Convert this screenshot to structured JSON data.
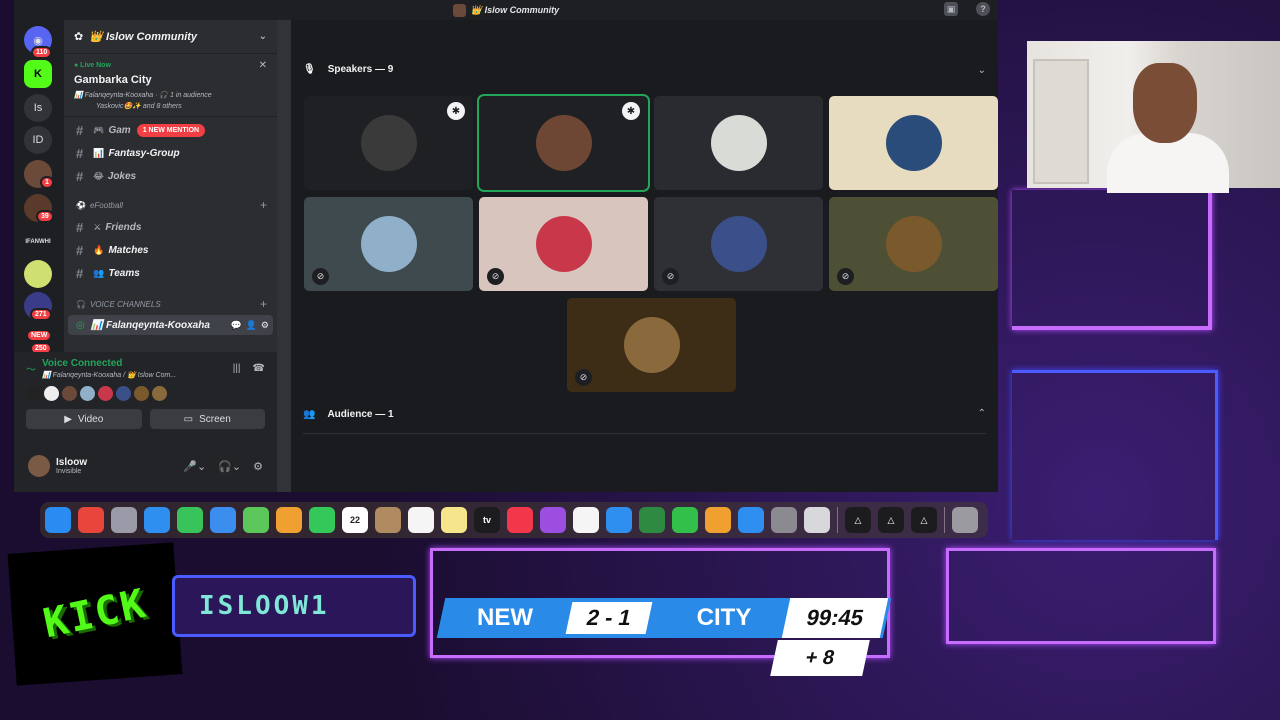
{
  "window": {
    "title": "👑 Islow Community"
  },
  "rail": {
    "items": [
      {
        "label": "",
        "badge": "110"
      },
      {
        "label": "",
        "badge": ""
      },
      {
        "label": "Is",
        "badge": ""
      },
      {
        "label": "ID",
        "badge": ""
      },
      {
        "label": "",
        "badge": "1"
      },
      {
        "label": "",
        "badge": "39"
      },
      {
        "label": "IFANWHI",
        "badge": ""
      },
      {
        "label": "",
        "badge": ""
      },
      {
        "label": "",
        "badge": "271"
      },
      {
        "label": "NEW",
        "badge": "250"
      }
    ]
  },
  "sidebar": {
    "server_name": "👑 Islow Community",
    "live_label": "● Live Now",
    "stage_title": "Gambarka City",
    "stage_meta": "📊 Falanqeynta-Kooxaha · 🎧 1 in audience",
    "stage_others": "Yaskovic🤩✨ and 8 others",
    "channels_top": [
      {
        "emoji": "🎮",
        "name": "Gam",
        "mention": "1 NEW MENTION"
      },
      {
        "emoji": "📊",
        "name": "Fantasy-Group",
        "mention": ""
      },
      {
        "emoji": "😂",
        "name": "Jokes",
        "mention": ""
      }
    ],
    "category_football": "eFootball",
    "channels_football": [
      {
        "emoji": "⚔",
        "name": "Friends"
      },
      {
        "emoji": "🔥",
        "name": "Matches"
      },
      {
        "emoji": "👥",
        "name": "Teams"
      }
    ],
    "category_voice": "VOICE CHANNELS",
    "voice_channel": "📊 Falanqeynta-Kooxaha"
  },
  "voice_panel": {
    "status": "Voice Connected",
    "location": "📊 Falanqeynta-Kooxaha / 👑 Islow Com...",
    "video_label": "Video",
    "screen_label": "Screen"
  },
  "user": {
    "name": "Isloow",
    "status": "Invisible"
  },
  "stage": {
    "speakers_label": "Speakers — 9",
    "audience_label": "Audience — 1",
    "tiles": [
      {
        "bg": "#1f2023",
        "pic": "#3a3a3a",
        "muted": false,
        "mod": true,
        "speaking": false
      },
      {
        "bg": "#1f2023",
        "pic": "#6d4634",
        "muted": false,
        "mod": true,
        "speaking": true
      },
      {
        "bg": "#2a2b30",
        "pic": "#d9dbd7",
        "muted": false,
        "mod": false,
        "speaking": false
      },
      {
        "bg": "#e8dcc0",
        "pic": "#2a4c7a",
        "muted": false,
        "mod": false,
        "speaking": false
      },
      {
        "bg": "#3e4a4e",
        "pic": "#8fb0c8",
        "muted": true,
        "mod": false,
        "speaking": false
      },
      {
        "bg": "#d8c5be",
        "pic": "#c8384a",
        "muted": true,
        "mod": false,
        "speaking": false
      },
      {
        "bg": "#2f3036",
        "pic": "#3b4f8a",
        "muted": true,
        "mod": false,
        "speaking": false
      },
      {
        "bg": "#4e5035",
        "pic": "#7a5a2c",
        "muted": true,
        "mod": false,
        "speaking": false
      },
      {
        "bg": "#3e2d16",
        "pic": "#8a6a3c",
        "muted": true,
        "mod": false,
        "speaking": false
      }
    ]
  },
  "dock": {
    "items": [
      {
        "name": "finder-icon",
        "color": "#2a8cf0",
        "text": ""
      },
      {
        "name": "chrome-icon",
        "color": "#e8453c",
        "text": ""
      },
      {
        "name": "launchpad-icon",
        "color": "#9a9aa8",
        "text": ""
      },
      {
        "name": "safari-icon",
        "color": "#2f8ff0",
        "text": ""
      },
      {
        "name": "messages-icon",
        "color": "#38c45a",
        "text": ""
      },
      {
        "name": "mail-icon",
        "color": "#3b8df0",
        "text": ""
      },
      {
        "name": "maps-icon",
        "color": "#5cc85c",
        "text": ""
      },
      {
        "name": "photos-icon",
        "color": "#f0a030",
        "text": ""
      },
      {
        "name": "facetime-icon",
        "color": "#34c75a",
        "text": ""
      },
      {
        "name": "calendar-icon",
        "color": "#ffffff",
        "text": "22"
      },
      {
        "name": "contacts-icon",
        "color": "#b08a60",
        "text": ""
      },
      {
        "name": "reminders-icon",
        "color": "#f5f5f5",
        "text": ""
      },
      {
        "name": "notes-icon",
        "color": "#f6e58a",
        "text": ""
      },
      {
        "name": "tv-icon",
        "color": "#1c1c1e",
        "text": "tv"
      },
      {
        "name": "music-icon",
        "color": "#f2374a",
        "text": ""
      },
      {
        "name": "podcasts-icon",
        "color": "#9b4ee0",
        "text": ""
      },
      {
        "name": "news-icon",
        "color": "#f5f5f5",
        "text": ""
      },
      {
        "name": "keynote-icon",
        "color": "#2f8ff0",
        "text": ""
      },
      {
        "name": "game-icon",
        "color": "#2e8a40",
        "text": ""
      },
      {
        "name": "numbers-icon",
        "color": "#33c04a",
        "text": ""
      },
      {
        "name": "pages-icon",
        "color": "#f0a030",
        "text": ""
      },
      {
        "name": "app-store-icon",
        "color": "#2f8ff0",
        "text": ""
      },
      {
        "name": "system-settings-icon",
        "color": "#8a8a90",
        "text": ""
      },
      {
        "name": "iphone-mirroring-icon",
        "color": "#d8d8dc",
        "text": ""
      },
      {
        "name": "obs-a-icon",
        "color": "#1c1c1e",
        "text": "△"
      },
      {
        "name": "obs-b-icon",
        "color": "#1c1c1e",
        "text": "△"
      },
      {
        "name": "obs-c-icon",
        "color": "#1c1c1e",
        "text": "△"
      },
      {
        "name": "trash-icon",
        "color": "#9a9aa0",
        "text": ""
      }
    ]
  },
  "overlay": {
    "kick": "KICK",
    "channel_name": "ISLOOW1",
    "home_team": "NEW",
    "score": "2 - 1",
    "away_team": "CITY",
    "clock": "99:45",
    "added_time": "+ 8"
  }
}
